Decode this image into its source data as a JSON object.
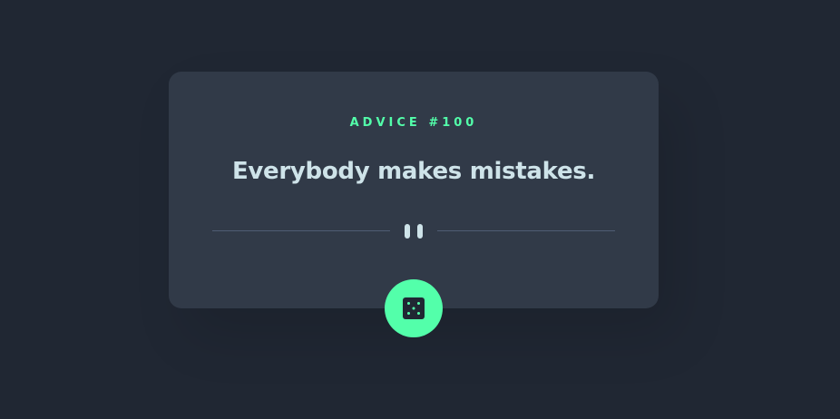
{
  "advice": {
    "label": "ADVICE #100",
    "text": "Everybody makes mistakes."
  },
  "controls": {
    "generate_icon": "dice-icon",
    "divider_icon": "pause-icon"
  },
  "colors": {
    "background": "#202733",
    "card": "#313a48",
    "accent": "#53ffaa",
    "text": "#cee3e9",
    "divider": "#4f5d74"
  }
}
